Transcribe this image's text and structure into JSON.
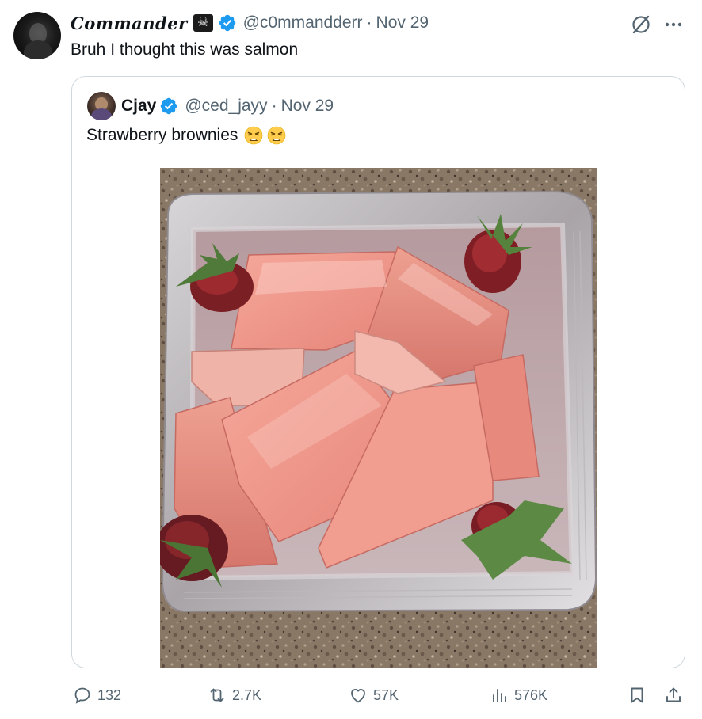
{
  "tweet": {
    "display_name": "Commander",
    "name_emoji": "☠",
    "handle": "@c0mmandderr",
    "separator": "·",
    "date": "Nov 29",
    "text": "Bruh I thought this was salmon"
  },
  "quoted_tweet": {
    "display_name": "Cjay",
    "handle": "@ced_jayy",
    "separator": "·",
    "date": "Nov 29",
    "text": "Strawberry brownies",
    "emojis": [
      "weary-face",
      "weary-face"
    ],
    "image_description_icon": "photo"
  },
  "actions": {
    "replies": "132",
    "reposts": "2.7K",
    "likes": "57K",
    "views": "576K"
  },
  "colors": {
    "text_primary": "#0f1419",
    "text_secondary": "#536471",
    "verified": "#1d9bf0",
    "border": "#cfd9de"
  },
  "icons": [
    "grok-icon",
    "more-icon",
    "verified-badge-icon",
    "reply-icon",
    "repost-icon",
    "like-icon",
    "views-icon",
    "bookmark-icon",
    "share-icon"
  ]
}
